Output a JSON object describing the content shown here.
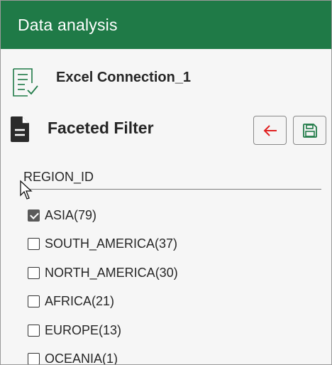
{
  "window": {
    "title": "Data analysis"
  },
  "connection": {
    "name": "Excel Connection_1",
    "icon": "spreadsheet-check-icon"
  },
  "filter_panel": {
    "title": "Faceted Filter",
    "buttons": [
      {
        "name": "back-button",
        "icon": "arrow-left-icon",
        "color": "#e02020"
      },
      {
        "name": "save-button",
        "icon": "floppy-disk-icon",
        "color": "#1f7a47"
      }
    ],
    "field": "REGION_ID",
    "facets": [
      {
        "label": "ASIA(79)",
        "checked": true
      },
      {
        "label": "SOUTH_AMERICA(37)",
        "checked": false
      },
      {
        "label": "NORTH_AMERICA(30)",
        "checked": false
      },
      {
        "label": "AFRICA(21)",
        "checked": false
      },
      {
        "label": "EUROPE(13)",
        "checked": false
      },
      {
        "label": "OCEANIA(1)",
        "checked": false
      }
    ]
  },
  "colors": {
    "titlebar": "#1f7a47",
    "accent_green": "#1f7a47",
    "back_red": "#e02020"
  }
}
